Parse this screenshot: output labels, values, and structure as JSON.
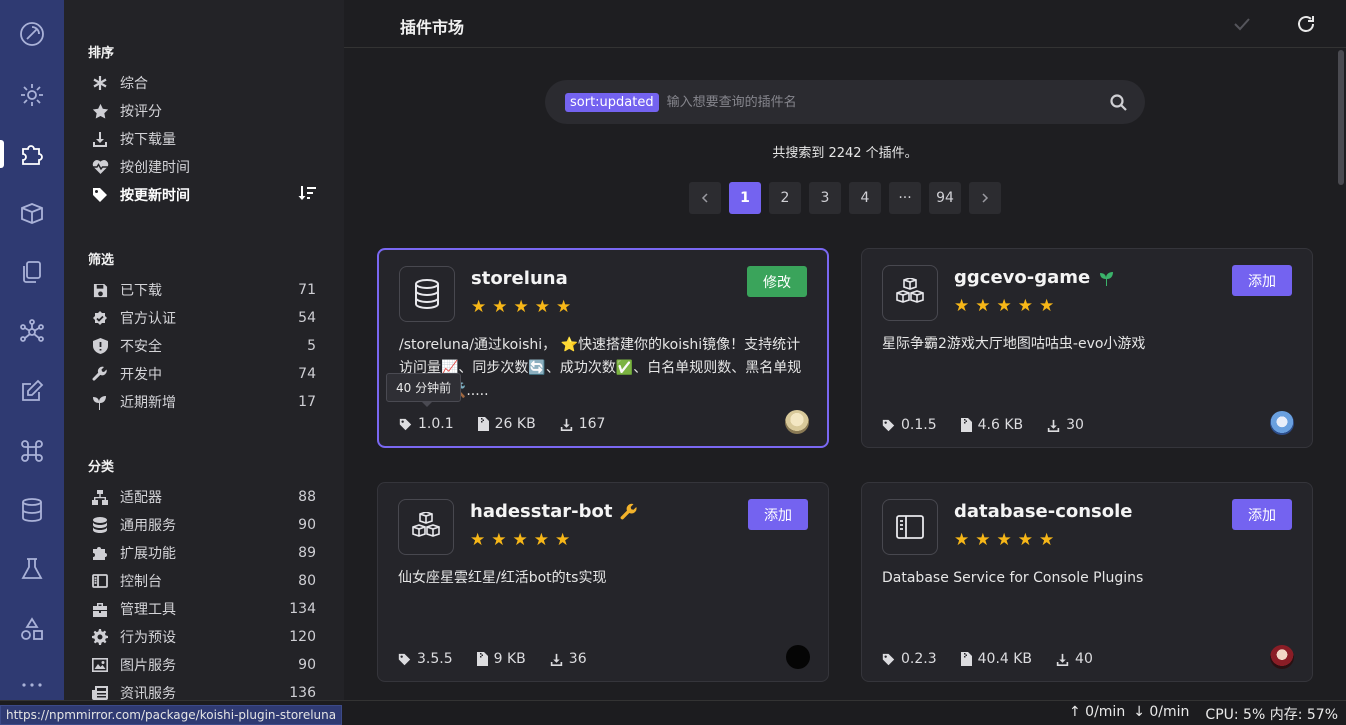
{
  "topbar": {
    "title": "插件市场"
  },
  "sidebar": {
    "sort_title": "排序",
    "sort_items": [
      {
        "label": "综合"
      },
      {
        "label": "按评分"
      },
      {
        "label": "按下载量"
      },
      {
        "label": "按创建时间"
      },
      {
        "label": "按更新时间"
      }
    ],
    "filter_title": "筛选",
    "filter_items": [
      {
        "label": "已下载",
        "count": "71"
      },
      {
        "label": "官方认证",
        "count": "54"
      },
      {
        "label": "不安全",
        "count": "5"
      },
      {
        "label": "开发中",
        "count": "74"
      },
      {
        "label": "近期新增",
        "count": "17"
      }
    ],
    "category_title": "分类",
    "category_items": [
      {
        "label": "适配器",
        "count": "88"
      },
      {
        "label": "通用服务",
        "count": "90"
      },
      {
        "label": "扩展功能",
        "count": "89"
      },
      {
        "label": "控制台",
        "count": "80"
      },
      {
        "label": "管理工具",
        "count": "134"
      },
      {
        "label": "行为预设",
        "count": "120"
      },
      {
        "label": "图片服务",
        "count": "90"
      },
      {
        "label": "资讯服务",
        "count": "136"
      }
    ]
  },
  "search": {
    "chip": "sort:updated",
    "placeholder": "输入想要查询的插件名"
  },
  "result_count": "共搜索到 2242 个插件。",
  "pagination": {
    "pages": [
      "1",
      "2",
      "3",
      "4",
      "···",
      "94"
    ]
  },
  "tooltip": "40 分钟前",
  "cards": [
    {
      "name": "storeluna",
      "button": "修改",
      "desc": "/storeluna/通过koishi， ⭐快速搭建你的koishi镜像！支持统计访问量📈、同步次数🔄、成功次数✅、白名单规则数、黑名单规则数🔴 🛠️.....",
      "version": "1.0.1",
      "size": "26 KB",
      "downloads": "167"
    },
    {
      "name": "ggcevo-game",
      "button": "添加",
      "desc": "星际争霸2游戏大厅地图咕咕虫-evo小游戏",
      "version": "0.1.5",
      "size": "4.6 KB",
      "downloads": "30"
    },
    {
      "name": "hadesstar-bot",
      "button": "添加",
      "desc": "仙女座星雲红星/红活bot的ts实现",
      "version": "3.5.5",
      "size": "9 KB",
      "downloads": "36"
    },
    {
      "name": "database-console",
      "button": "添加",
      "desc": "Database Service for Console Plugins",
      "version": "0.2.3",
      "size": "40.4 KB",
      "downloads": "40"
    }
  ],
  "status": {
    "url": "https://npmmirror.com/package/koishi-plugin-storeluna",
    "up": "↑ 0/min",
    "down": "↓ 0/min",
    "cpu": "CPU: 5% 内存: 57%"
  },
  "colors": {
    "accent": "#7463f0",
    "rail": "#2f3a72",
    "edit_button": "#3aa45b",
    "star": "#f7b718"
  }
}
